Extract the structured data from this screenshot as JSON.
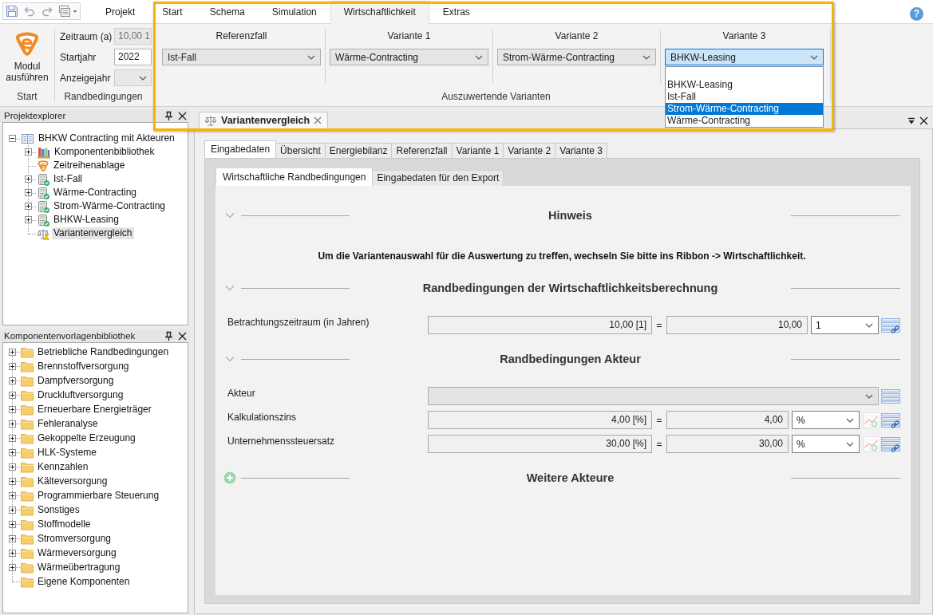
{
  "ribbon": {
    "tabs": [
      {
        "label": "Projekt",
        "selected": false
      },
      {
        "label": "Start",
        "selected": false
      },
      {
        "label": "Schema",
        "selected": false
      },
      {
        "label": "Simulation",
        "selected": false
      },
      {
        "label": "Wirtschaftlichkeit",
        "selected": true
      },
      {
        "label": "Extras",
        "selected": false
      }
    ],
    "help": "?",
    "run_group": {
      "button": "Modul ausführen",
      "caption": "Start"
    },
    "conditions_group": {
      "caption": "Randbedingungen",
      "fields": [
        {
          "label": "Zeitraum (a)",
          "kind": "text",
          "value": "10,00 1",
          "disabled": true
        },
        {
          "label": "Startjahr",
          "kind": "text",
          "value": "2022",
          "disabled": false
        },
        {
          "label": "Anzeigejahr",
          "kind": "dropdown",
          "disabled": true
        }
      ]
    },
    "variants_group": {
      "caption": "Auszuwertende Varianten",
      "variants": [
        {
          "label": "Referenzfall",
          "value": "Ist-Fall",
          "open": false
        },
        {
          "label": "Variante 1",
          "value": "Wärme-Contracting",
          "open": false
        },
        {
          "label": "Variante 2",
          "value": "Strom-Wärme-Contracting",
          "open": false
        },
        {
          "label": "Variante 3",
          "value": "BHKW-Leasing",
          "open": true
        }
      ],
      "dropdown_list": {
        "options": [
          {
            "label": "BHKW-Leasing",
            "selected": false
          },
          {
            "label": "Ist-Fall",
            "selected": false
          },
          {
            "label": "Strom-Wärme-Contracting",
            "selected": true
          },
          {
            "label": "Wärme-Contracting",
            "selected": false
          }
        ]
      }
    }
  },
  "project_explorer": {
    "title": "Projektexplorer",
    "tree": [
      {
        "label": "BHKW Contracting mit Akteuren",
        "kind": "project",
        "expanded": true,
        "selected": false,
        "children": [
          {
            "label": "Komponentenbibliothek",
            "kind": "library",
            "expanded": false,
            "selected": false
          },
          {
            "label": "Zeitreihenablage",
            "kind": "timeseries",
            "selected": false
          },
          {
            "label": "Ist-Fall",
            "kind": "variant",
            "expanded": false,
            "selected": false
          },
          {
            "label": "Wärme-Contracting",
            "kind": "variant",
            "expanded": false,
            "selected": false
          },
          {
            "label": "Strom-Wärme-Contracting",
            "kind": "variant",
            "expanded": false,
            "selected": false
          },
          {
            "label": "BHKW-Leasing",
            "kind": "variant",
            "expanded": false,
            "selected": false
          },
          {
            "label": "Variantenvergleich",
            "kind": "comparison",
            "selected": true
          }
        ]
      }
    ]
  },
  "component_library": {
    "title": "Komponentenvorlagenbibliothek",
    "tree": [
      {
        "label": "Betriebliche Randbedingungen",
        "kind": "folder",
        "expanded": false,
        "selected": false
      },
      {
        "label": "Brennstoffversorgung",
        "kind": "folder",
        "expanded": false,
        "selected": false
      },
      {
        "label": "Dampfversorgung",
        "kind": "folder",
        "expanded": false,
        "selected": false
      },
      {
        "label": "Druckluftversorgung",
        "kind": "folder",
        "expanded": false,
        "selected": false
      },
      {
        "label": "Erneuerbare Energieträger",
        "kind": "folder",
        "expanded": false,
        "selected": false
      },
      {
        "label": "Fehleranalyse",
        "kind": "folder",
        "expanded": false,
        "selected": false
      },
      {
        "label": "Gekoppelte Erzeugung",
        "kind": "folder",
        "expanded": false,
        "selected": false
      },
      {
        "label": "HLK-Systeme",
        "kind": "folder",
        "expanded": false,
        "selected": false
      },
      {
        "label": "Kennzahlen",
        "kind": "folder",
        "expanded": false,
        "selected": false
      },
      {
        "label": "Kälteversorgung",
        "kind": "folder",
        "expanded": false,
        "selected": false
      },
      {
        "label": "Programmierbare Steuerung",
        "kind": "folder",
        "expanded": false,
        "selected": false
      },
      {
        "label": "Sonstiges",
        "kind": "folder",
        "expanded": false,
        "selected": false
      },
      {
        "label": "Stoffmodelle",
        "kind": "folder",
        "expanded": false,
        "selected": false
      },
      {
        "label": "Stromversorgung",
        "kind": "folder",
        "expanded": false,
        "selected": false
      },
      {
        "label": "Wärmeversorgung",
        "kind": "folder",
        "expanded": false,
        "selected": false
      },
      {
        "label": "Wärmeübertragung",
        "kind": "folder",
        "expanded": false,
        "selected": false
      },
      {
        "label": "Eigene Komponenten",
        "kind": "folder",
        "selected": false
      }
    ]
  },
  "document": {
    "tabs": [
      {
        "label": "Variantenvergleich",
        "selected": true
      }
    ],
    "view_tabs": [
      {
        "label": "Eingabedaten",
        "selected": true
      },
      {
        "label": "Übersicht",
        "selected": false
      },
      {
        "label": "Energiebilanz",
        "selected": false
      },
      {
        "label": "Referenzfall",
        "selected": false
      },
      {
        "label": "Variante 1",
        "selected": false
      },
      {
        "label": "Variante 2",
        "selected": false
      },
      {
        "label": "Variante 3",
        "selected": false
      }
    ],
    "sub_tabs": [
      {
        "label": "Wirtschaftliche Randbedingungen",
        "selected": true
      },
      {
        "label": "Eingabedaten für den Export",
        "selected": false
      }
    ],
    "sections": [
      {
        "kind": "collapsible",
        "title": "Hinweis",
        "note": "Um die Variantenauswahl für die Auswertung zu treffen, wechseln Sie bitte ins Ribbon -> Wirtschaftlichkeit."
      },
      {
        "kind": "collapsible",
        "title": "Randbedingungen der Wirtschaftlichkeitsberechnung",
        "rows": [
          {
            "label": "Betrachtungszeitraum (in Jahren)",
            "kind": "quantity",
            "formula": "10,00 [1]",
            "operator": "=",
            "result": "10,00",
            "unit": "1",
            "chart_button": false
          }
        ]
      },
      {
        "kind": "collapsible",
        "title": "Randbedingungen Akteur",
        "rows": [
          {
            "label": "Akteur",
            "kind": "select"
          },
          {
            "label": "Kalkulationszins",
            "kind": "quantity",
            "formula": "4,00 [%]",
            "operator": "=",
            "result": "4,00",
            "unit": "%",
            "chart_button": true
          },
          {
            "label": "Unternehmenssteuersatz",
            "kind": "quantity",
            "formula": "30,00 [%]",
            "operator": "=",
            "result": "30,00",
            "unit": "%",
            "chart_button": true
          }
        ]
      },
      {
        "kind": "add",
        "title": "Weitere Akteure"
      }
    ]
  }
}
